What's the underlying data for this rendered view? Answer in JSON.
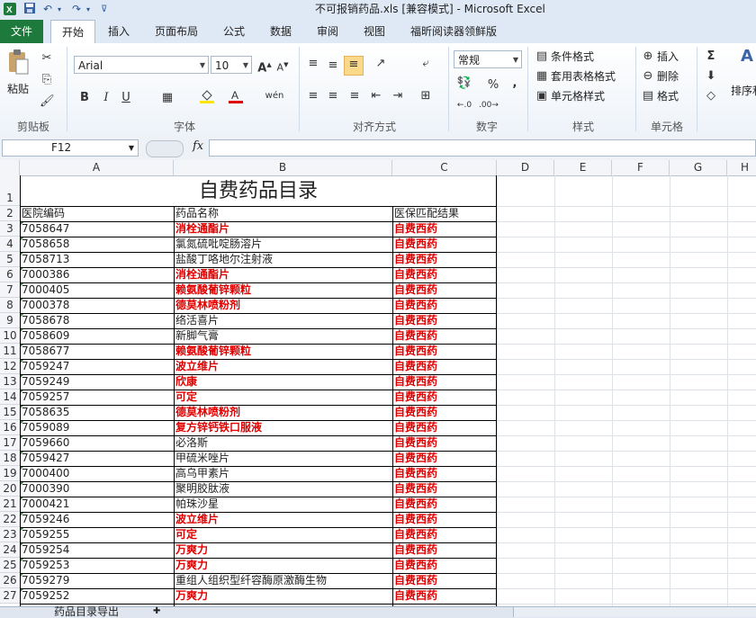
{
  "window": {
    "title": "不可报销药品.xls  [兼容模式]  -  Microsoft Excel"
  },
  "tabs": [
    {
      "label": "文件"
    },
    {
      "label": "开始"
    },
    {
      "label": "插入"
    },
    {
      "label": "页面布局"
    },
    {
      "label": "公式"
    },
    {
      "label": "数据"
    },
    {
      "label": "审阅"
    },
    {
      "label": "视图"
    },
    {
      "label": "福昕阅读器领鲜版"
    }
  ],
  "ribbon": {
    "clipboard": {
      "paste": "粘贴",
      "label": "剪贴板"
    },
    "font": {
      "name": "Arial",
      "size": "10",
      "label": "字体",
      "bold": "B",
      "italic": "I",
      "underline": "U",
      "wen": "wén"
    },
    "alignment": {
      "label": "对齐方式"
    },
    "number": {
      "format": "常规",
      "label": "数字",
      "percent": "%",
      "comma": ","
    },
    "styles": {
      "conditional": "条件格式",
      "table": "套用表格格式",
      "cell": "单元格样式",
      "label": "样式"
    },
    "cells": {
      "insert": "插入",
      "delete": "删除",
      "format": "格式",
      "label": "单元格"
    },
    "editing": {
      "sort": "排序和"
    }
  },
  "formula_bar": {
    "name_box": "F12",
    "fx": "fx",
    "content": ""
  },
  "columns": [
    "A",
    "B",
    "C",
    "D",
    "E",
    "F",
    "G",
    "H"
  ],
  "sheet": {
    "title": "自费药品目录",
    "headers": [
      "医院编码",
      "药品名称",
      "医保匹配结果"
    ],
    "rows": [
      {
        "row": "3",
        "code": "7058647",
        "name": "消栓通酯片",
        "result": "自费西药",
        "highlight": true
      },
      {
        "row": "4",
        "code": "7058658",
        "name": "氯氮硫吡啶肠溶片",
        "result": "自费西药",
        "highlight": false
      },
      {
        "row": "5",
        "code": "7058713",
        "name": "盐酸丁咯地尔注射液",
        "result": "自费西药",
        "highlight": false
      },
      {
        "row": "6",
        "code": "7000386",
        "name": "消栓通酯片",
        "result": "自费西药",
        "highlight": true
      },
      {
        "row": "7",
        "code": "7000405",
        "name": "赖氨酸葡锌颗粒",
        "result": "自费西药",
        "highlight": true
      },
      {
        "row": "8",
        "code": "7000378",
        "name": "德莫林喷粉剂",
        "result": "自费西药",
        "highlight": true
      },
      {
        "row": "9",
        "code": "7058678",
        "name": "络活喜片",
        "result": "自费西药",
        "highlight": false
      },
      {
        "row": "10",
        "code": "7058609",
        "name": "新脚气膏",
        "result": "自费西药",
        "highlight": false
      },
      {
        "row": "11",
        "code": "7058677",
        "name": "赖氨酸葡锌颗粒",
        "result": "自费西药",
        "highlight": true
      },
      {
        "row": "12",
        "code": "7059247",
        "name": "波立维片",
        "result": "自费西药",
        "highlight": true
      },
      {
        "row": "13",
        "code": "7059249",
        "name": "欣康",
        "result": "自费西药",
        "highlight": true
      },
      {
        "row": "14",
        "code": "7059257",
        "name": "可定",
        "result": "自费西药",
        "highlight": true
      },
      {
        "row": "15",
        "code": "7058635",
        "name": "德莫林喷粉剂",
        "result": "自费西药",
        "highlight": true
      },
      {
        "row": "16",
        "code": "7059089",
        "name": "复方锌钙铁口服液",
        "result": "自费西药",
        "highlight": true
      },
      {
        "row": "17",
        "code": "7059660",
        "name": "必洛斯",
        "result": "自费西药",
        "highlight": false
      },
      {
        "row": "18",
        "code": "7059427",
        "name": "甲硫米唑片",
        "result": "自费西药",
        "highlight": false
      },
      {
        "row": "19",
        "code": "7000400",
        "name": "高乌甲素片",
        "result": "自费西药",
        "highlight": false
      },
      {
        "row": "20",
        "code": "7000390",
        "name": "聚明胶肽液",
        "result": "自费西药",
        "highlight": false
      },
      {
        "row": "21",
        "code": "7000421",
        "name": "帕珠沙星",
        "result": "自费西药",
        "highlight": false
      },
      {
        "row": "22",
        "code": "7059246",
        "name": "波立维片",
        "result": "自费西药",
        "highlight": true
      },
      {
        "row": "23",
        "code": "7059255",
        "name": "可定",
        "result": "自费西药",
        "highlight": true
      },
      {
        "row": "24",
        "code": "7059254",
        "name": "万爽力",
        "result": "自费西药",
        "highlight": true
      },
      {
        "row": "25",
        "code": "7059253",
        "name": "万爽力",
        "result": "自费西药",
        "highlight": true
      },
      {
        "row": "26",
        "code": "7059279",
        "name": "重组人组织型纤容酶原激酶生物",
        "result": "自费西药",
        "highlight": false
      },
      {
        "row": "27",
        "code": "7059252",
        "name": "万爽力",
        "result": "自费西药",
        "highlight": true
      }
    ]
  },
  "sheet_tabs": [
    {
      "label": "药品目录导出"
    }
  ],
  "colors": {
    "red": "#e00000",
    "file_tab": "#1e7a3c",
    "ribbon_bg": "#dfe9f5"
  },
  "icons": [
    "excel-icon",
    "save-icon",
    "undo-icon",
    "redo-icon",
    "paste-icon",
    "cut-icon",
    "copy-icon",
    "format-painter-icon",
    "fill-color-icon",
    "font-color-icon",
    "sum-icon",
    "sort-icon"
  ]
}
